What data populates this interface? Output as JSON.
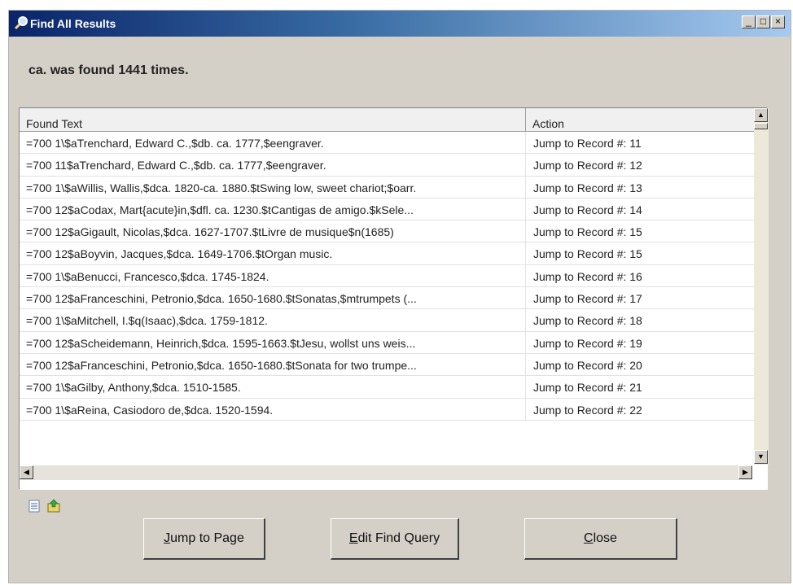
{
  "window": {
    "title": "Find All Results",
    "min_label": "_",
    "max_label": "□",
    "close_label": "×"
  },
  "summary": "ca. was found 1441 times.",
  "table": {
    "columns": [
      "Found Text",
      "Action"
    ],
    "rows": [
      {
        "found": "=700  1\\$aTrenchard, Edward C.,$db. ca. 1777,$eengraver.",
        "action": "Jump to Record #: 11"
      },
      {
        "found": "=700  11$aTrenchard, Edward C.,$db. ca. 1777,$eengraver.",
        "action": "Jump to Record #: 12"
      },
      {
        "found": "=700  1\\$aWillis, Wallis,$dca. 1820-ca. 1880.$tSwing low, sweet chariot;$oarr.",
        "action": "Jump to Record #: 13"
      },
      {
        "found": "=700  12$aCodax, Mart{acute}in,$dfl. ca. 1230.$tCantigas de amigo.$kSele...",
        "action": "Jump to Record #: 14"
      },
      {
        "found": "=700  12$aGigault, Nicolas,$dca. 1627-1707.$tLivre de musique$n(1685)",
        "action": "Jump to Record #: 15"
      },
      {
        "found": "=700  12$aBoyvin, Jacques,$dca. 1649-1706.$tOrgan music.",
        "action": "Jump to Record #: 15"
      },
      {
        "found": "=700  1\\$aBenucci, Francesco,$dca. 1745-1824.",
        "action": "Jump to Record #: 16"
      },
      {
        "found": "=700  12$aFranceschini, Petronio,$dca. 1650-1680.$tSonatas,$mtrumpets (...",
        "action": "Jump to Record #: 17"
      },
      {
        "found": "=700  1\\$aMitchell, I.$q(Isaac),$dca. 1759-1812.",
        "action": "Jump to Record #: 18"
      },
      {
        "found": "=700  12$aScheidemann, Heinrich,$dca. 1595-1663.$tJesu, wollst uns weis...",
        "action": "Jump to Record #: 19"
      },
      {
        "found": "=700  12$aFranceschini, Petronio,$dca. 1650-1680.$tSonata for two trumpe...",
        "action": "Jump to Record #: 20"
      },
      {
        "found": "=700  1\\$aGilby, Anthony,$dca. 1510-1585.",
        "action": "Jump to Record #: 21"
      },
      {
        "found": "=700  1\\$aReina, Casiodoro de,$dca. 1520-1594.",
        "action": "Jump to Record #: 22"
      }
    ]
  },
  "toolbar_icons": [
    "list-icon",
    "export-icon"
  ],
  "buttons": {
    "jump_u": "J",
    "jump_rest": "ump to Page",
    "edit_u": "E",
    "edit_rest": "dit Find Query",
    "close_u": "C",
    "close_rest": "lose"
  }
}
